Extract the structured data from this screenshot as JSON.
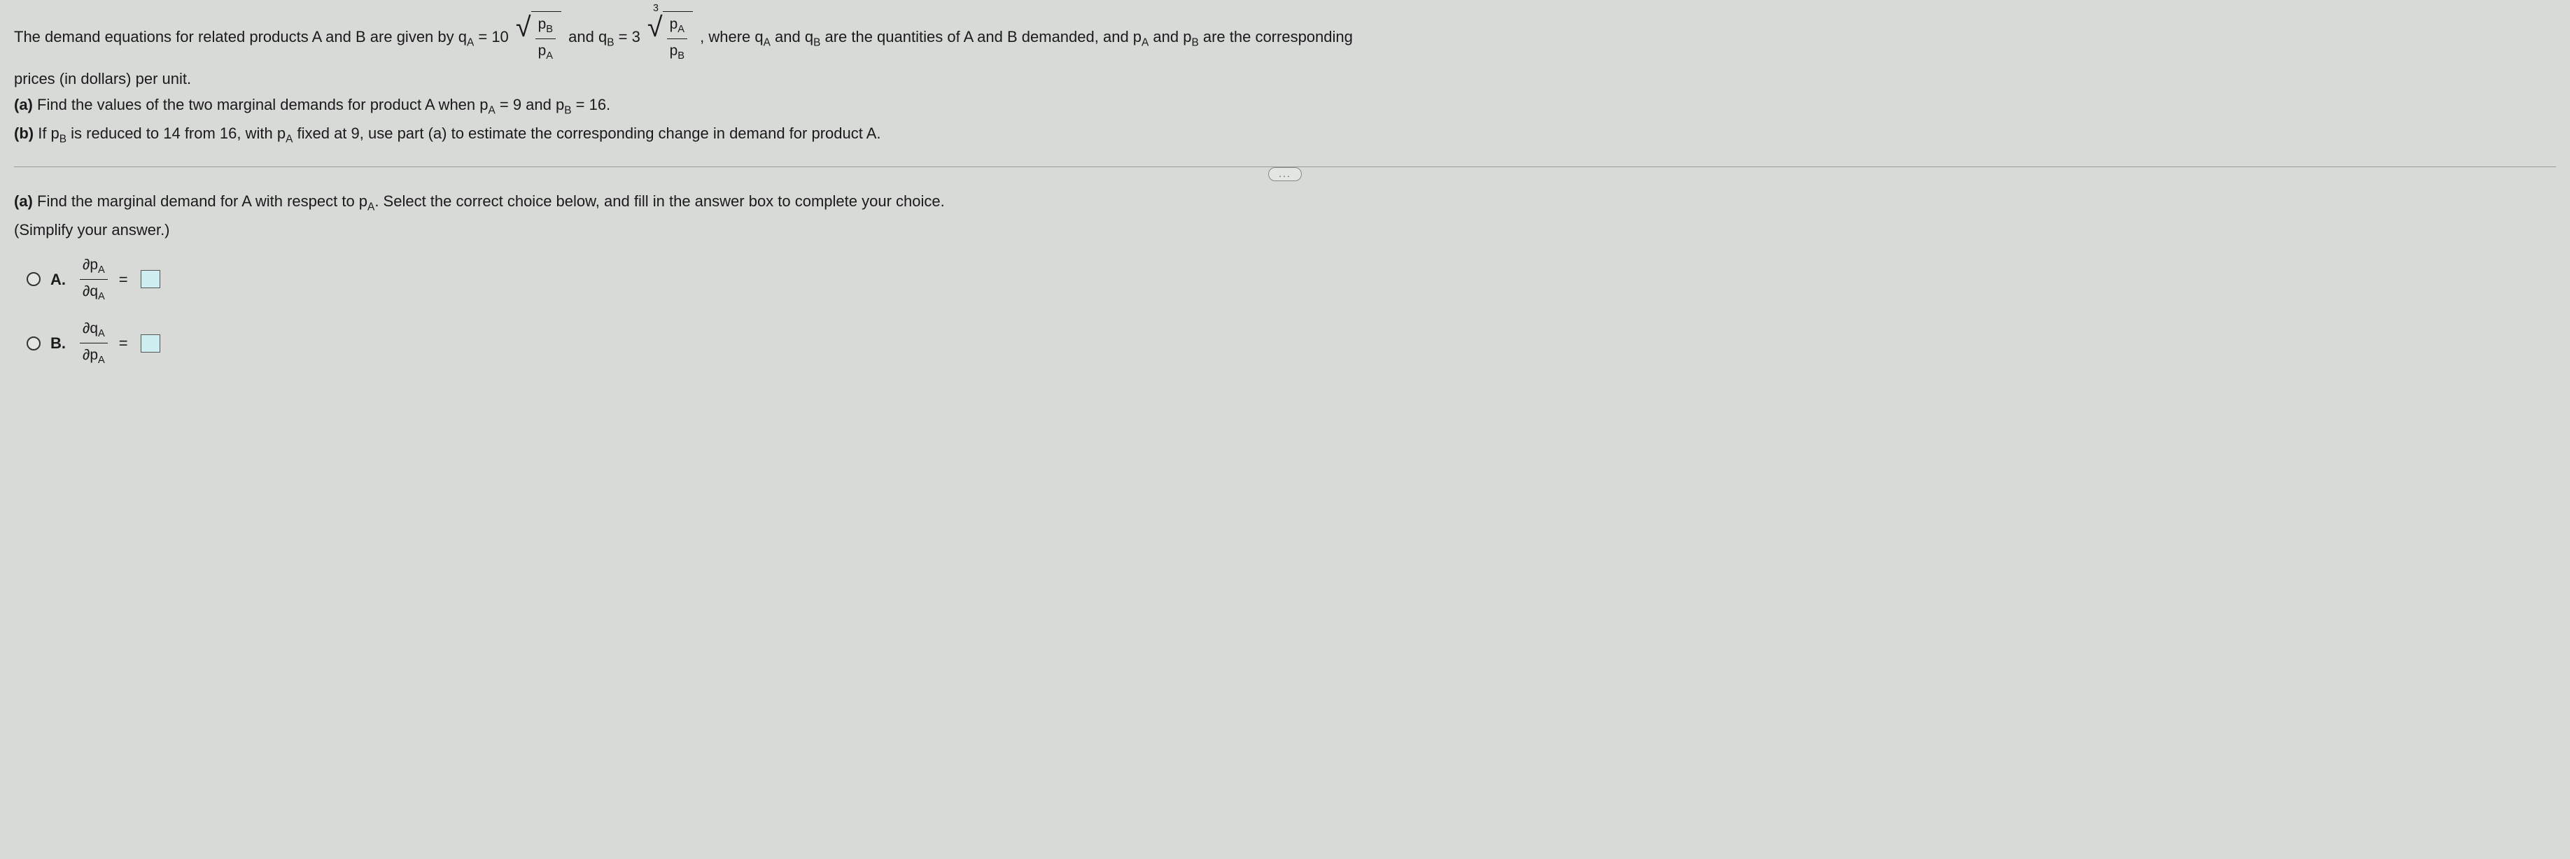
{
  "intro_part1": "The demand equations for related products A and B are given by q",
  "sub_A": "A",
  "equals_10": " = 10",
  "frac_pB": "p",
  "frac_pA": "p",
  "and_qB": " and q",
  "sub_B": "B",
  "equals_3": " = 3",
  "root_index": "3",
  "where_text": " , where q",
  "and_q": " and q",
  "are_quantities": " are the quantities of A and B demanded, and p",
  "and_p": " and p",
  "are_corresponding": " are the corresponding",
  "prices_line": "prices (in dollars) per unit.",
  "part_a_label": "(a)",
  "part_a_text1": " Find the values of the two marginal demands for product A when p",
  "part_a_text2": " = 9 and p",
  "part_a_text3": " = 16.",
  "part_b_label": "(b)",
  "part_b_text1": " If p",
  "part_b_text2": " is reduced to 14 from 16, with p",
  "part_b_text3": " fixed at 9, use part (a) to estimate the corresponding change in demand for product A.",
  "expand_dots": "...",
  "question_a_label": "(a)",
  "question_a_text1": " Find the marginal demand for A with respect to p",
  "question_a_text2": ". Select the correct choice below, and fill in the answer box to complete your choice.",
  "simplify_text": "(Simplify your answer.)",
  "choice_A_label": "A.",
  "choice_B_label": "B.",
  "partial": "∂",
  "pA_text": "p",
  "qA_text": "q",
  "equals": " = "
}
